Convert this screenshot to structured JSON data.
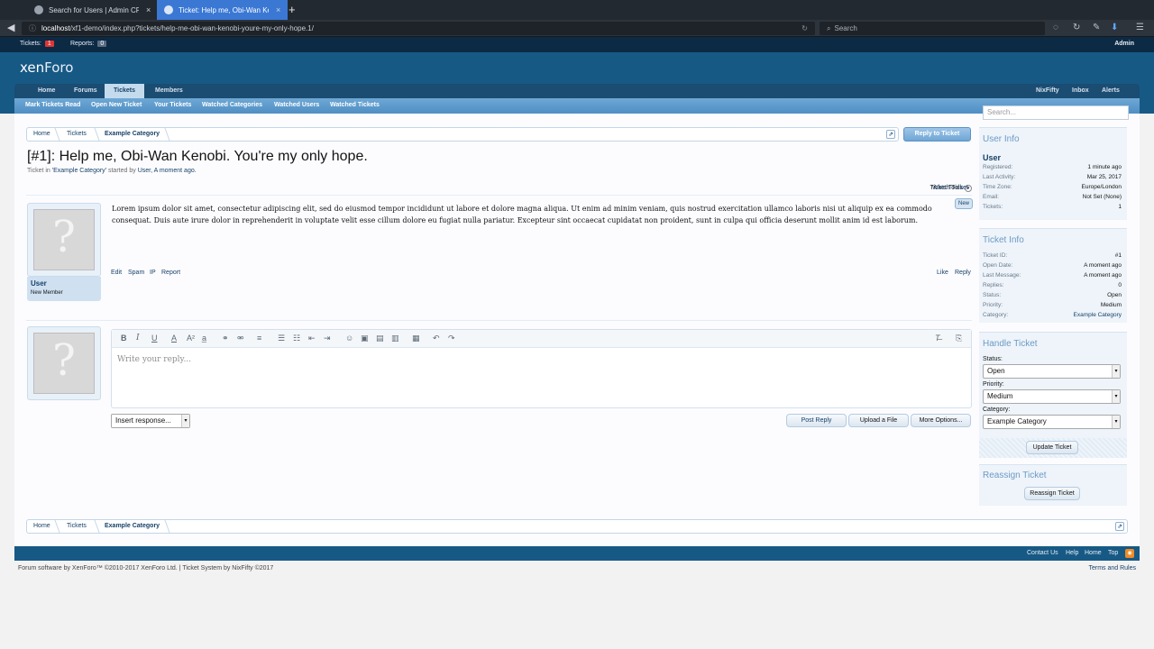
{
  "browser": {
    "tabs": [
      {
        "label": "Search for Users | Admin CP"
      },
      {
        "label": "Ticket: Help me, Obi-Wan Ke..."
      }
    ],
    "close_glyph": "×",
    "new_tab_glyph": "+",
    "url_host": "localhost",
    "url_path": "/xf1-demo/index.php?tickets/help-me-obi-wan-kenobi-youre-my-only-hope.1/",
    "search_placeholder": "Search"
  },
  "admin_bar": {
    "tickets_label": "Tickets:",
    "tickets_count": "1",
    "reports_label": "Reports:",
    "reports_count": "0",
    "admin_label": "Admin"
  },
  "header": {
    "logo_a": "xen",
    "logo_b": "Foro",
    "nav": [
      "Home",
      "Forums",
      "Tickets",
      "Members"
    ],
    "nav_right": [
      "NixFifty",
      "Inbox",
      "Alerts"
    ],
    "subnav": [
      "Mark Tickets Read",
      "Open New Ticket",
      "Your Tickets",
      "Watched Categories",
      "Watched Users",
      "Watched Tickets"
    ]
  },
  "breadcrumb": [
    "Home",
    "Tickets",
    "Example Category"
  ],
  "reply_button": "Reply to Ticket",
  "ticket": {
    "title": "[#1]: Help me, Obi-Wan Kenobi. You're my only hope.",
    "byline_prefix": "Ticket in",
    "byline_category": "'Example Category'",
    "byline_mid": "started by",
    "byline_user": "User",
    "byline_time": ", A moment ago.",
    "tools": "Ticket Tools",
    "watch": "Watch Ticket"
  },
  "post": {
    "username": "User",
    "user_title": "New Member",
    "body": "Lorem ipsum dolor sit amet, consectetur adipiscing elit, sed do eiusmod tempor incididunt ut labore et dolore magna aliqua. Ut enim ad minim veniam, quis nostrud exercitation ullamco laboris nisi ut aliquip ex ea commodo consequat. Duis aute irure dolor in reprehenderit in voluptate velit esse cillum dolore eu fugiat nulla pariatur. Excepteur sint occaecat cupidatat non proident, sunt in culpa qui officia deserunt mollit anim id est laborum.",
    "new_badge": "New",
    "actions": [
      "Edit",
      "Spam",
      "IP",
      "Report"
    ],
    "like": "Like",
    "reply": "Reply"
  },
  "editor": {
    "placeholder": "Write your reply...",
    "insert_response": "Insert response...",
    "post_reply": "Post Reply",
    "upload": "Upload a File",
    "more_options": "More Options..."
  },
  "sidebar": {
    "search_placeholder": "Search...",
    "user_info": {
      "heading": "User Info",
      "username": "User",
      "rows": [
        {
          "k": "Registered:",
          "v": "1 minute ago"
        },
        {
          "k": "Last Activity:",
          "v": "Mar 25, 2017"
        },
        {
          "k": "Time Zone:",
          "v": "Europe/London"
        },
        {
          "k": "Email:",
          "v": "Not Set (None)"
        },
        {
          "k": "Tickets:",
          "v": "1"
        }
      ]
    },
    "ticket_info": {
      "heading": "Ticket Info",
      "rows": [
        {
          "k": "Ticket ID:",
          "v": "#1"
        },
        {
          "k": "Open Date:",
          "v": "A moment ago"
        },
        {
          "k": "Last Message:",
          "v": "A moment ago"
        },
        {
          "k": "Replies:",
          "v": "0"
        },
        {
          "k": "Status:",
          "v": "Open"
        },
        {
          "k": "Priority:",
          "v": "Medium"
        },
        {
          "k": "Category:",
          "v": "Example Category"
        }
      ]
    },
    "handle_ticket": {
      "heading": "Handle Ticket",
      "status_label": "Status:",
      "status_value": "Open",
      "priority_label": "Priority:",
      "priority_value": "Medium",
      "category_label": "Category:",
      "category_value": "Example Category",
      "update_button": "Update Ticket"
    },
    "reassign": {
      "heading": "Reassign Ticket",
      "button": "Reassign Ticket"
    }
  },
  "footer": {
    "links": [
      "Contact Us",
      "Help",
      "Home",
      "Top"
    ],
    "copyright": "Forum software by XenForo™ ©2010-2017 XenForo Ltd. | Ticket System by NixFifty ©2017",
    "terms": "Terms and Rules"
  }
}
